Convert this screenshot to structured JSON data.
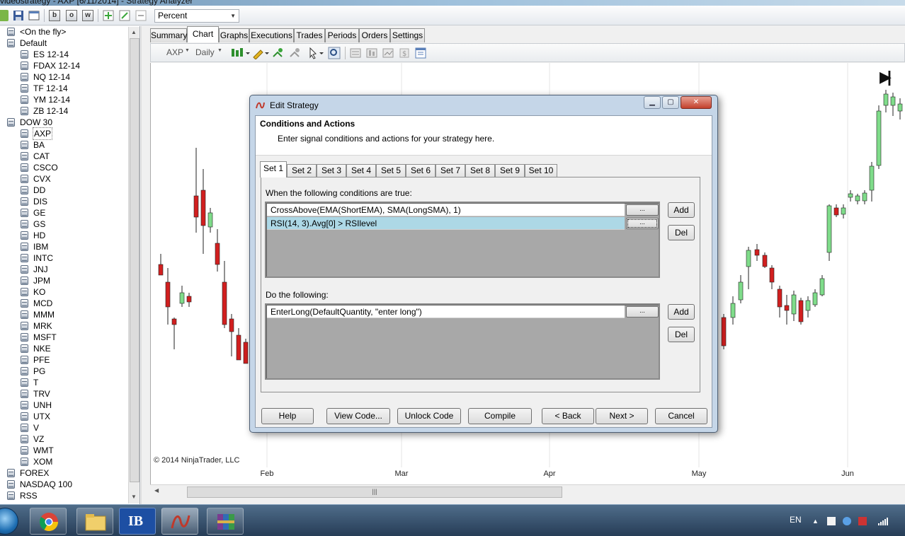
{
  "window": {
    "title": "videostrategy - AXP [6/11/2014] - Strategy Analyzer"
  },
  "toolbar": {
    "letter_buttons": [
      "b",
      "o",
      "w"
    ],
    "display_mode": "Percent"
  },
  "tree": {
    "groups": [
      {
        "label": "<On the fly>",
        "children": []
      },
      {
        "label": "Default",
        "children": [
          "ES 12-14",
          "FDAX 12-14",
          "NQ 12-14",
          "TF 12-14",
          "YM 12-14",
          "ZB 12-14"
        ]
      },
      {
        "label": "DOW 30",
        "children": [
          "AXP",
          "BA",
          "CAT",
          "CSCO",
          "CVX",
          "DD",
          "DIS",
          "GE",
          "GS",
          "HD",
          "IBM",
          "INTC",
          "JNJ",
          "JPM",
          "KO",
          "MCD",
          "MMM",
          "MRK",
          "MSFT",
          "NKE",
          "PFE",
          "PG",
          "T",
          "TRV",
          "UNH",
          "UTX",
          "V",
          "VZ",
          "WMT",
          "XOM"
        ]
      },
      {
        "label": "FOREX",
        "children": []
      },
      {
        "label": "NASDAQ 100",
        "children": []
      },
      {
        "label": "RSS",
        "children": []
      }
    ],
    "selected": "AXP"
  },
  "tabs": [
    "Summary",
    "Chart",
    "Graphs",
    "Executions",
    "Trades",
    "Periods",
    "Orders",
    "Settings"
  ],
  "active_tab": "Chart",
  "chart_toolbar": {
    "instrument": "AXP",
    "interval": "Daily"
  },
  "chart": {
    "copyright": "© 2014 NinjaTrader, LLC",
    "x_labels": [
      "Feb",
      "Mar",
      "Apr",
      "May",
      "Jun"
    ]
  },
  "dialog": {
    "title": "Edit Strategy",
    "heading": "Conditions and Actions",
    "subheading": "Enter signal conditions and actions for your strategy here.",
    "set_tabs": [
      "Set 1",
      "Set 2",
      "Set 3",
      "Set 4",
      "Set 5",
      "Set 6",
      "Set 7",
      "Set 8",
      "Set 9",
      "Set 10"
    ],
    "active_set": "Set 1",
    "conditions_label": "When the following conditions are true:",
    "conditions": [
      "CrossAbove(EMA(ShortEMA), SMA(LongSMA), 1)",
      "RSI(14, 3).Avg[0] > RSIlevel"
    ],
    "selected_condition_index": 1,
    "actions_label": "Do the following:",
    "actions": [
      "EnterLong(DefaultQuantity, \"enter long\")"
    ],
    "ellipsis_label": "...",
    "add_label": "Add",
    "del_label": "Del",
    "buttons": {
      "help": "Help",
      "view_code": "View Code...",
      "unlock_code": "Unlock Code",
      "compile": "Compile",
      "back": "< Back",
      "next": "Next >",
      "cancel": "Cancel"
    }
  },
  "taskbar": {
    "language": "EN",
    "ib_label": "IB"
  }
}
